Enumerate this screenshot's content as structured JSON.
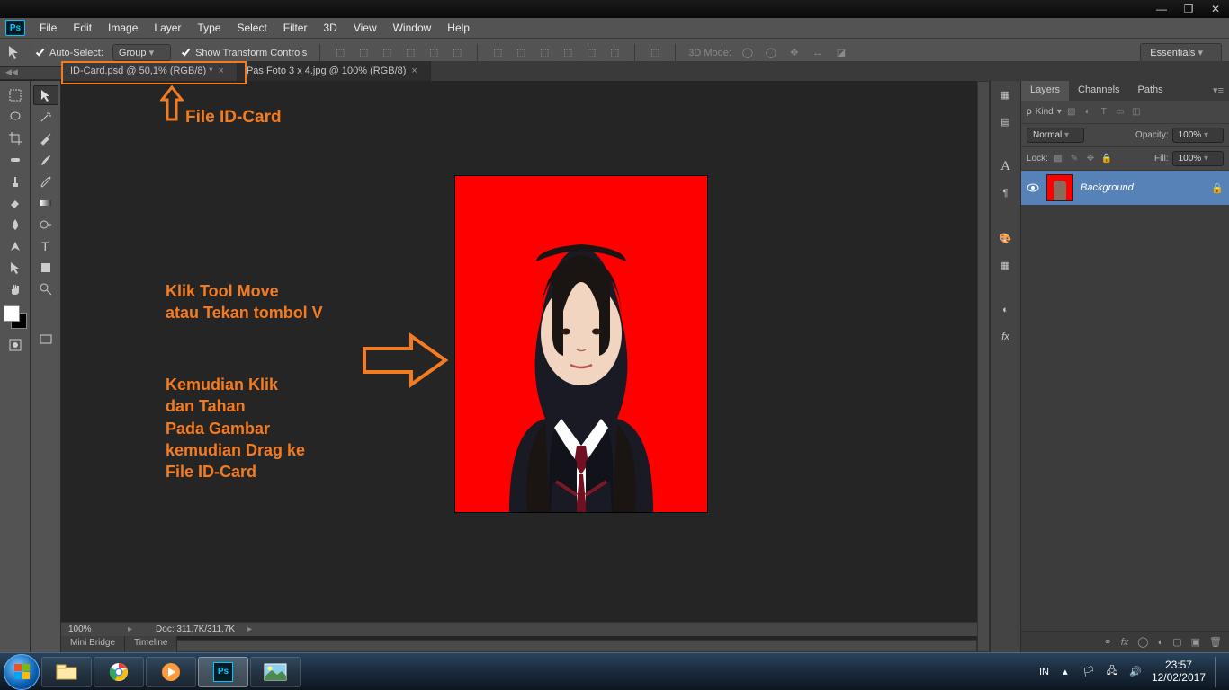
{
  "menu": {
    "items": [
      "File",
      "Edit",
      "Image",
      "Layer",
      "Type",
      "Select",
      "Filter",
      "3D",
      "View",
      "Window",
      "Help"
    ]
  },
  "options": {
    "auto_select": "Auto-Select:",
    "group": "Group",
    "show_transform": "Show Transform Controls",
    "mode3d": "3D Mode:",
    "workspace": "Essentials"
  },
  "tabs": {
    "tab1": "ID-Card.psd @ 50,1% (RGB/8) *",
    "tab2": "Pas Foto 3 x 4.jpg @ 100% (RGB/8)"
  },
  "annotations": {
    "file_label": "File ID-Card",
    "move_text": "Klik Tool Move\natau Tekan tombol V",
    "drag_text": "Kemudian Klik\ndan Tahan\nPada Gambar\nkemudian Drag ke\nFile ID-Card"
  },
  "status": {
    "zoom": "100%",
    "doc": "Doc: 311,7K/311,7K"
  },
  "bottom_panels": {
    "mini_bridge": "Mini Bridge",
    "timeline": "Timeline"
  },
  "layers": {
    "tab_layers": "Layers",
    "tab_channels": "Channels",
    "tab_paths": "Paths",
    "kind_label": "Kind",
    "blend_mode": "Normal",
    "opacity_label": "Opacity:",
    "opacity_val": "100%",
    "lock_label": "Lock:",
    "fill_label": "Fill:",
    "fill_val": "100%",
    "layer_name": "Background"
  },
  "taskbar": {
    "lang": "IN",
    "time": "23:57",
    "date": "12/02/2017"
  }
}
